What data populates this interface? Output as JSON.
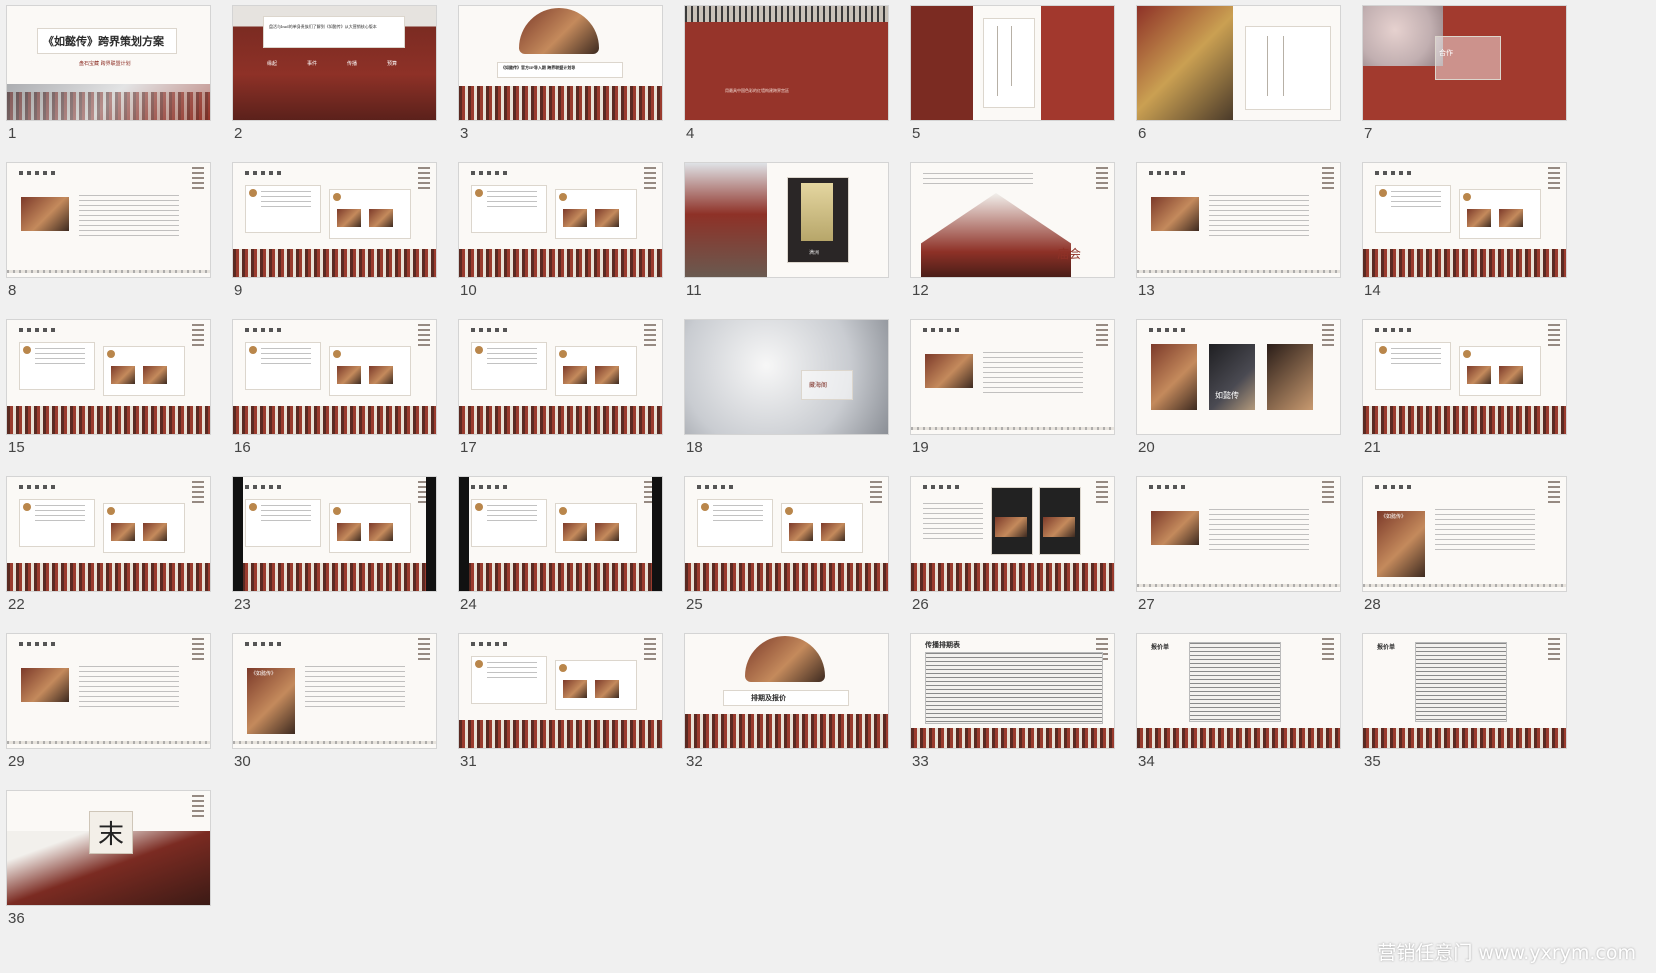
{
  "slides": [
    {
      "number": "1",
      "kind": "title",
      "title": "《如懿传》跨界策划方案",
      "subtitle": "盘石宝藏  跨界联盟计划"
    },
    {
      "number": "2",
      "kind": "toc",
      "text": "盘活与bud的单身贵族们了解到《如懿传》从大营销核心版本",
      "labels": [
        "缘起",
        "事件",
        "传播",
        "预算"
      ]
    },
    {
      "number": "3",
      "kind": "cast",
      "text": "《如懿传》官方IP导入期  跨界联盟计划导"
    },
    {
      "number": "4",
      "kind": "wall",
      "text": "用最具中国色彩的红墙构建跨界宫廷"
    },
    {
      "number": "5",
      "kind": "vertical"
    },
    {
      "number": "6",
      "kind": "vertical2"
    },
    {
      "number": "7",
      "kind": "snowwall",
      "text": "合作"
    },
    {
      "number": "8",
      "kind": "photoText"
    },
    {
      "number": "9",
      "kind": "weibo"
    },
    {
      "number": "10",
      "kind": "weibo"
    },
    {
      "number": "11",
      "kind": "palace",
      "text": "满洲"
    },
    {
      "number": "12",
      "kind": "pavilion",
      "text": "庙会"
    },
    {
      "number": "13",
      "kind": "photoText"
    },
    {
      "number": "14",
      "kind": "weibo"
    },
    {
      "number": "15",
      "kind": "weibo"
    },
    {
      "number": "16",
      "kind": "weibo"
    },
    {
      "number": "17",
      "kind": "weibo"
    },
    {
      "number": "18",
      "kind": "snowscape",
      "text": "藏海阁"
    },
    {
      "number": "19",
      "kind": "photoText"
    },
    {
      "number": "20",
      "kind": "posters",
      "text": "如懿传"
    },
    {
      "number": "21",
      "kind": "weibo"
    },
    {
      "number": "22",
      "kind": "weibo"
    },
    {
      "number": "23",
      "kind": "weiboBlack"
    },
    {
      "number": "24",
      "kind": "weiboBlack"
    },
    {
      "number": "25",
      "kind": "weibo"
    },
    {
      "number": "26",
      "kind": "phones"
    },
    {
      "number": "27",
      "kind": "photoText"
    },
    {
      "number": "28",
      "kind": "photoText",
      "text": "《如懿传》"
    },
    {
      "number": "29",
      "kind": "photoText"
    },
    {
      "number": "30",
      "kind": "photoText",
      "text": "《如懿传》"
    },
    {
      "number": "31",
      "kind": "weibo"
    },
    {
      "number": "32",
      "kind": "cast2",
      "text": "排期及报价"
    },
    {
      "number": "33",
      "kind": "table",
      "text": "传播排期表"
    },
    {
      "number": "34",
      "kind": "table2",
      "text": "报价单"
    },
    {
      "number": "35",
      "kind": "table2",
      "text": "报价单"
    },
    {
      "number": "36",
      "kind": "end",
      "text": "末"
    }
  ],
  "watermark": "营销任意门 www.yxrym.com",
  "colors": {
    "palaceRed": "#8e3127",
    "background": "#f0f0f0"
  }
}
